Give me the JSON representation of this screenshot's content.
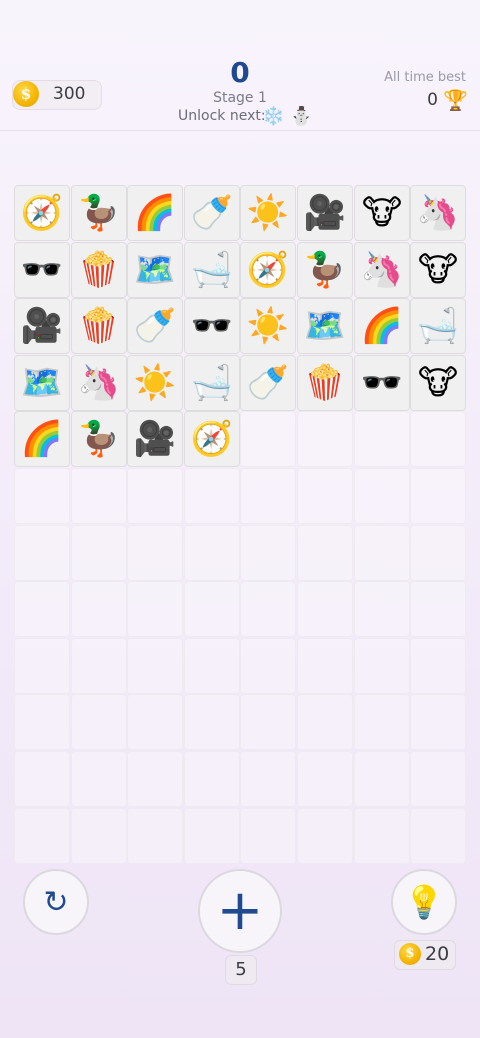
{
  "header": {
    "coins": "300",
    "coin_symbol": "$",
    "score": "0",
    "stage": "Stage 1",
    "unlock_label": "Unlock next:",
    "unlock_icons": "❄️ ⛄",
    "best_label": "All time best",
    "best_value": "0",
    "trophy_icon": "trophy-icon"
  },
  "board": {
    "columns": 8,
    "rows": 12,
    "tiles": [
      [
        "🧭",
        "🦆",
        "🌈",
        "🍼",
        "☀️",
        "🎥",
        "🐮",
        "🦄"
      ],
      [
        "🕶️",
        "🍿",
        "🗺️",
        "🛁",
        "🧭",
        "🦆",
        "🦄",
        "🐮"
      ],
      [
        "🎥",
        "🍿",
        "🍼",
        "🕶️",
        "☀️",
        "🗺️",
        "🌈",
        "🛁"
      ],
      [
        "🗺️",
        "🦄",
        "☀️",
        "🛁",
        "🍼",
        "🍿",
        "🕶️",
        "🐮"
      ],
      [
        "🌈",
        "🦆",
        "🎥",
        "🧭"
      ]
    ]
  },
  "controls": {
    "refresh_icon": "↻",
    "add_icon": "+",
    "add_count": "5",
    "hint_icon": "💡",
    "hint_cost": "20",
    "coin_symbol": "$"
  },
  "colors": {
    "accent": "#1f4a92",
    "coin": "#f5b400",
    "background": "#f4eefa"
  }
}
